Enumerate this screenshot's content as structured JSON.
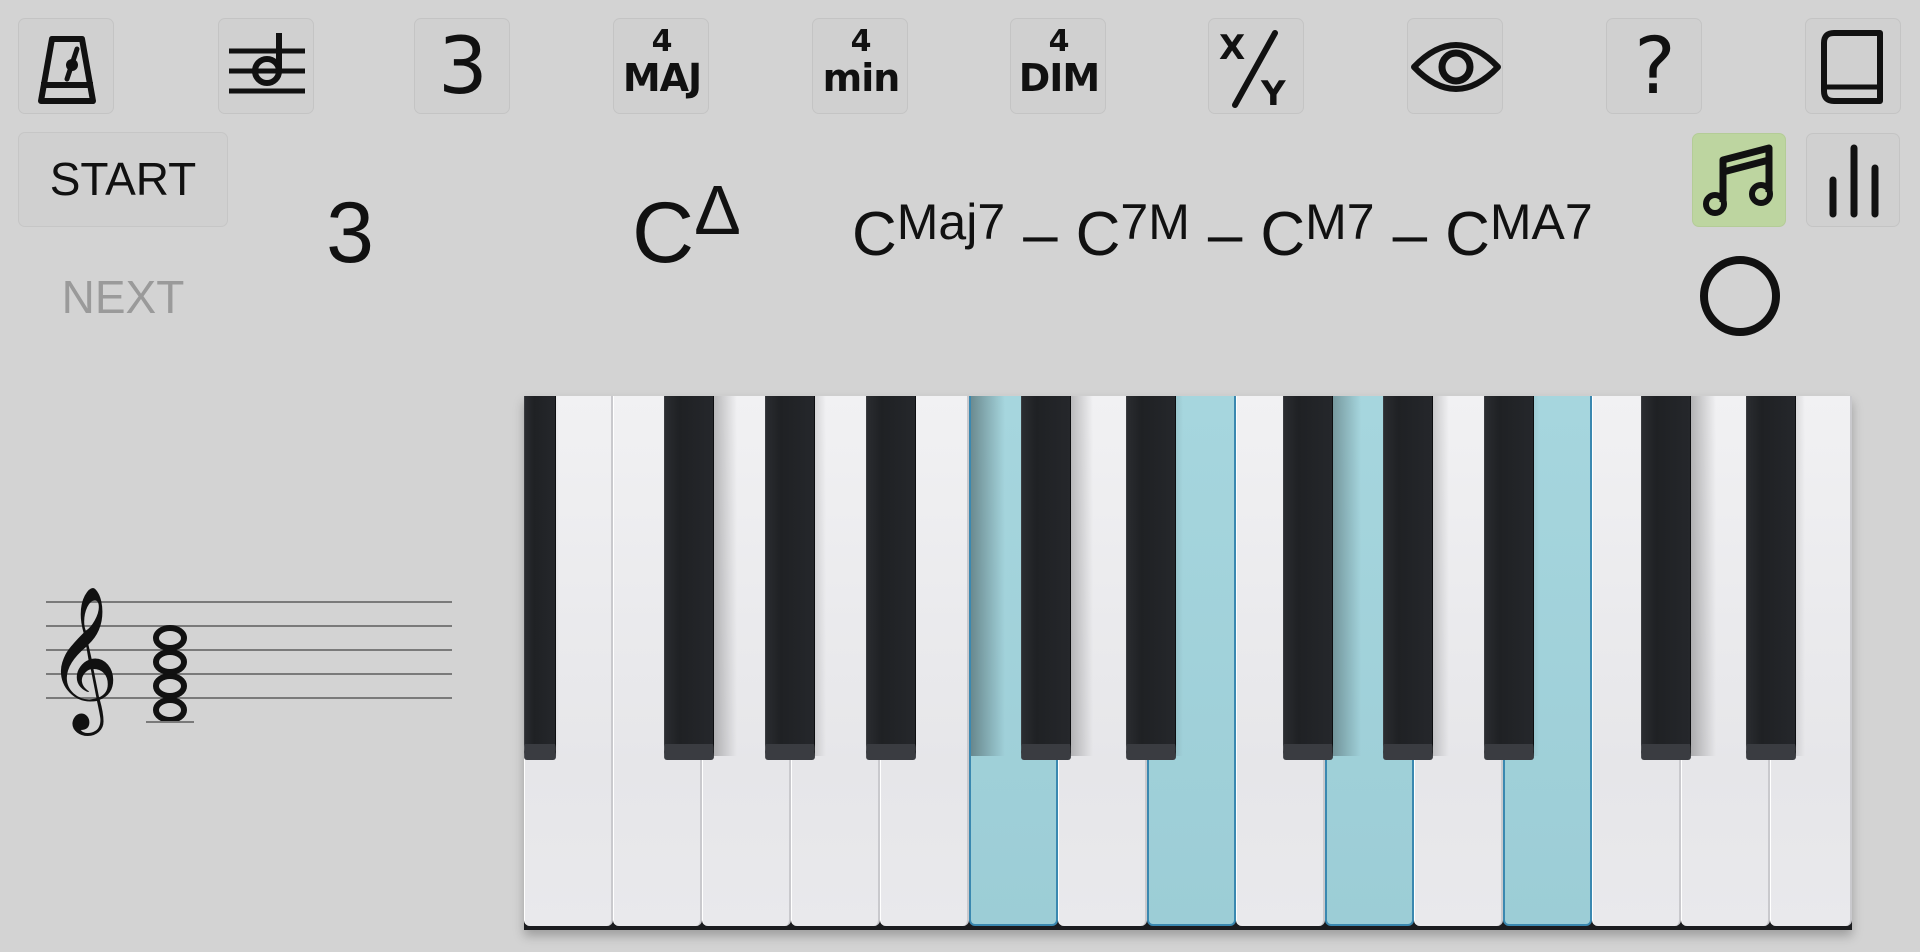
{
  "toolbar": {
    "buttons": [
      {
        "name": "metronome-icon"
      },
      {
        "name": "note-on-staff-icon"
      },
      {
        "label": "3"
      },
      {
        "top": "4",
        "bottom": "MAJ"
      },
      {
        "top": "4",
        "bottom": "min"
      },
      {
        "top": "4",
        "bottom": "DIM"
      },
      {
        "name": "slash-chord-icon"
      },
      {
        "name": "eye-icon"
      },
      {
        "label": "?"
      },
      {
        "name": "book-icon"
      }
    ]
  },
  "controls": {
    "start_label": "START",
    "next_label": "NEXT",
    "counter": "3"
  },
  "chord": {
    "root": "C",
    "main_quality": "Δ",
    "alternatives": [
      {
        "root": "C",
        "quality": "Maj7"
      },
      {
        "root": "C",
        "quality": "7M"
      },
      {
        "root": "C",
        "quality": "M7"
      },
      {
        "root": "C",
        "quality": "MA7"
      }
    ],
    "separator": "–"
  },
  "side_buttons": [
    {
      "name": "music-notes-icon",
      "active": true
    },
    {
      "name": "bar-graph-icon",
      "active": false
    },
    {
      "name": "circle-icon"
    }
  ],
  "keyboard": {
    "highlighted_white_keys": [
      5,
      7,
      9,
      11
    ],
    "highlight_color": "#9ccdd6"
  },
  "colors": {
    "background": "#d3d3d3",
    "active_button": "#bdd5a0",
    "disabled_text": "#9a9a9a"
  }
}
